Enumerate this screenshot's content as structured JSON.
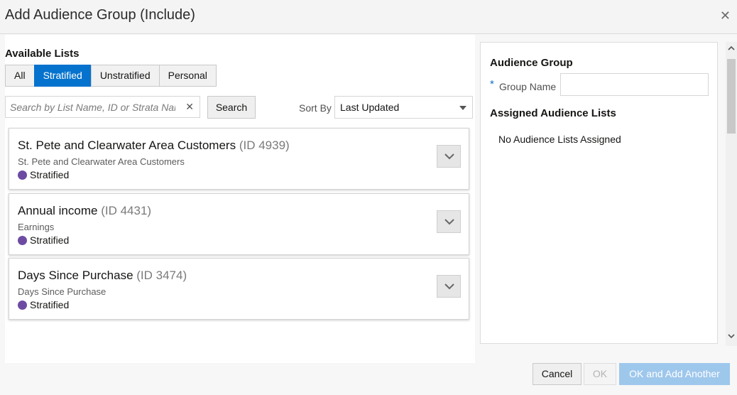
{
  "dialog": {
    "title": "Add Audience Group (Include)",
    "close_icon": "close-icon"
  },
  "available_lists": {
    "title": "Available Lists",
    "filters": [
      {
        "label": "All",
        "active": false
      },
      {
        "label": "Stratified",
        "active": true
      },
      {
        "label": "Unstratified",
        "active": false
      },
      {
        "label": "Personal",
        "active": false
      }
    ],
    "search": {
      "placeholder": "Search by List Name, ID or Strata Name",
      "value": "",
      "button_label": "Search"
    },
    "sort": {
      "label": "Sort By",
      "selected": "Last Updated"
    },
    "items": [
      {
        "name": "St. Pete and Clearwater Area Customers",
        "id": "(ID 4939)",
        "description": "St. Pete and Clearwater Area Customers",
        "type": "Stratified"
      },
      {
        "name": "Annual income",
        "id": "(ID 4431)",
        "description": "Earnings",
        "type": "Stratified"
      },
      {
        "name": "Days Since Purchase",
        "id": "(ID 3474)",
        "description": "Days Since Purchase",
        "type": "Stratified"
      }
    ]
  },
  "audience_group": {
    "title": "Audience Group",
    "required_marker": "*",
    "group_name_label": "Group Name",
    "group_name_value": "",
    "assigned_title": "Assigned Audience Lists",
    "assigned_empty": "No Audience Lists Assigned"
  },
  "footer": {
    "cancel": "Cancel",
    "ok": "OK",
    "ok_and_add": "OK and Add Another"
  },
  "colors": {
    "accent": "#0572ce",
    "stratified_dot": "#6e4ba3",
    "disabled_primary": "#9ec7ec"
  }
}
